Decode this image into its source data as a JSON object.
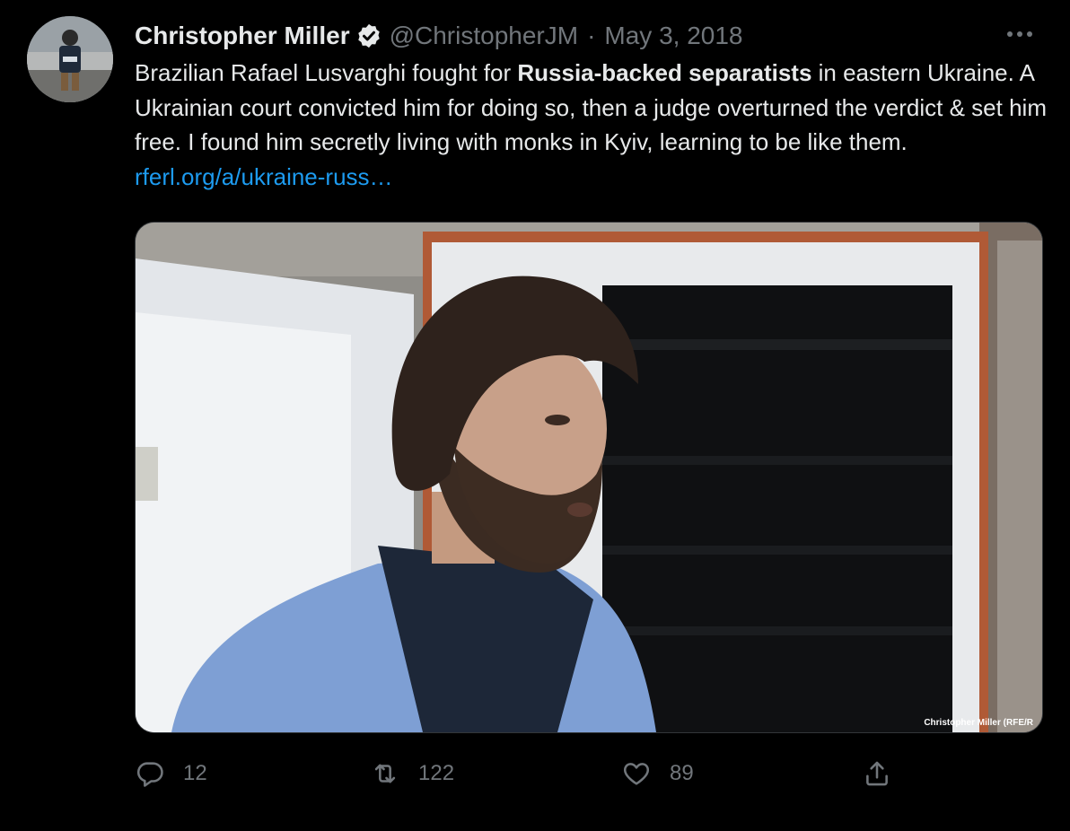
{
  "tweet": {
    "author": {
      "name": "Christopher Miller",
      "handle": "@ChristopherJM",
      "verified": true
    },
    "separator": "·",
    "date": "May 3, 2018",
    "text": {
      "part1": "Brazilian Rafael Lusvarghi fought for ",
      "bold": "Russia-backed separatists",
      "part2": " in eastern Ukraine. A Ukrainian court convicted him for doing so, then a judge overturned the verdict & set him free. I found him secretly living with monks in Kyiv, learning to be like them. ",
      "link": "rferl.org/a/ukraine-russ…"
    },
    "media": {
      "credit": "Christopher Miller (RFE/R"
    },
    "stats": {
      "replies": "12",
      "retweets": "122",
      "likes": "89"
    }
  },
  "icons": {
    "verified": "verified-badge-icon",
    "more": "more-horizontal-icon",
    "reply": "reply-icon",
    "retweet": "retweet-icon",
    "like": "heart-icon",
    "share": "share-icon"
  },
  "colors": {
    "background": "#000000",
    "text": "#e7e9ea",
    "secondary": "#71767b",
    "link": "#1d9bf0"
  }
}
